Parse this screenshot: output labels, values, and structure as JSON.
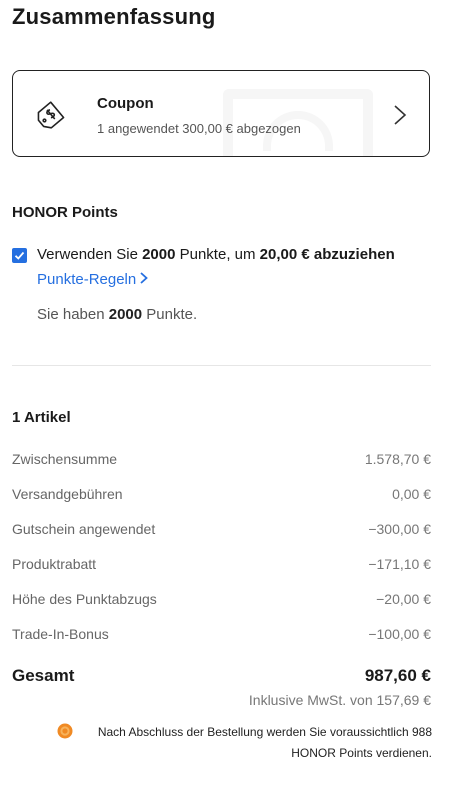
{
  "page": {
    "title": "Zusammenfassung"
  },
  "coupon": {
    "title": "Coupon",
    "subtitle": "1 angewendet 300,00 € abgezogen",
    "icon": "tag-dollar-icon",
    "chevron_icon": "chevron-right-icon"
  },
  "points": {
    "title": "HONOR Points",
    "checked": true,
    "use_prefix": "Verwenden Sie ",
    "use_points": "2000",
    "use_middle": " Punkte, um ",
    "use_amount": "20,00 € abzuziehen",
    "rules_link": "Punkte-Regeln",
    "have_prefix": "Sie haben ",
    "have_points": "2000",
    "have_suffix": " Punkte."
  },
  "summary": {
    "items_title": "1 Artikel",
    "rows": [
      {
        "label": "Zwischensumme",
        "value": "1.578,70 €"
      },
      {
        "label": "Versandgebühren",
        "value": "0,00 €"
      },
      {
        "label": "Gutschein angewendet",
        "value": "−300,00 €"
      },
      {
        "label": "Produktrabatt",
        "value": "−171,10 €"
      },
      {
        "label": "Höhe des Punktabzugs",
        "value": "−20,00 €"
      },
      {
        "label": "Trade-In-Bonus",
        "value": "−100,00 €"
      }
    ],
    "total_label": "Gesamt",
    "total_value": "987,60 €",
    "vat_note": "Inklusive MwSt. von 157,69 €",
    "earn_note": "Nach Abschluss der Bestellung werden Sie voraussichtlich 988 HONOR Points verdienen.",
    "earn_icon": "honor-coin-icon"
  },
  "colors": {
    "accent": "#256fe0",
    "coin": "#f08a24"
  }
}
